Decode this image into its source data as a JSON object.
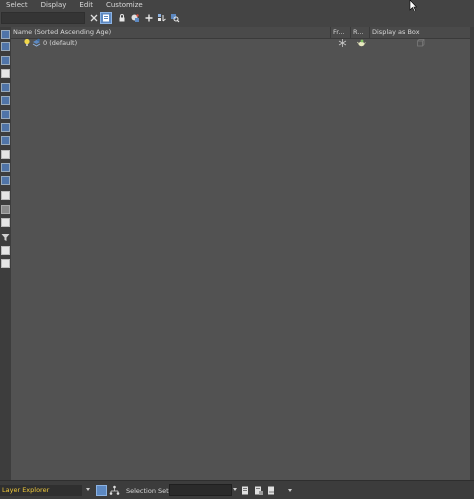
{
  "menu": {
    "items": [
      "Select",
      "Display",
      "Edit",
      "Customize"
    ]
  },
  "table": {
    "columns": [
      "Name (Sorted Ascending Age)",
      "Fr...",
      "R...",
      "Display as Box"
    ],
    "rows": [
      {
        "name": "0 (default)"
      }
    ]
  },
  "status": {
    "panel_name": "Layer Explorer",
    "selection_set_label": "Selection Set:",
    "selection_set_value": ""
  }
}
